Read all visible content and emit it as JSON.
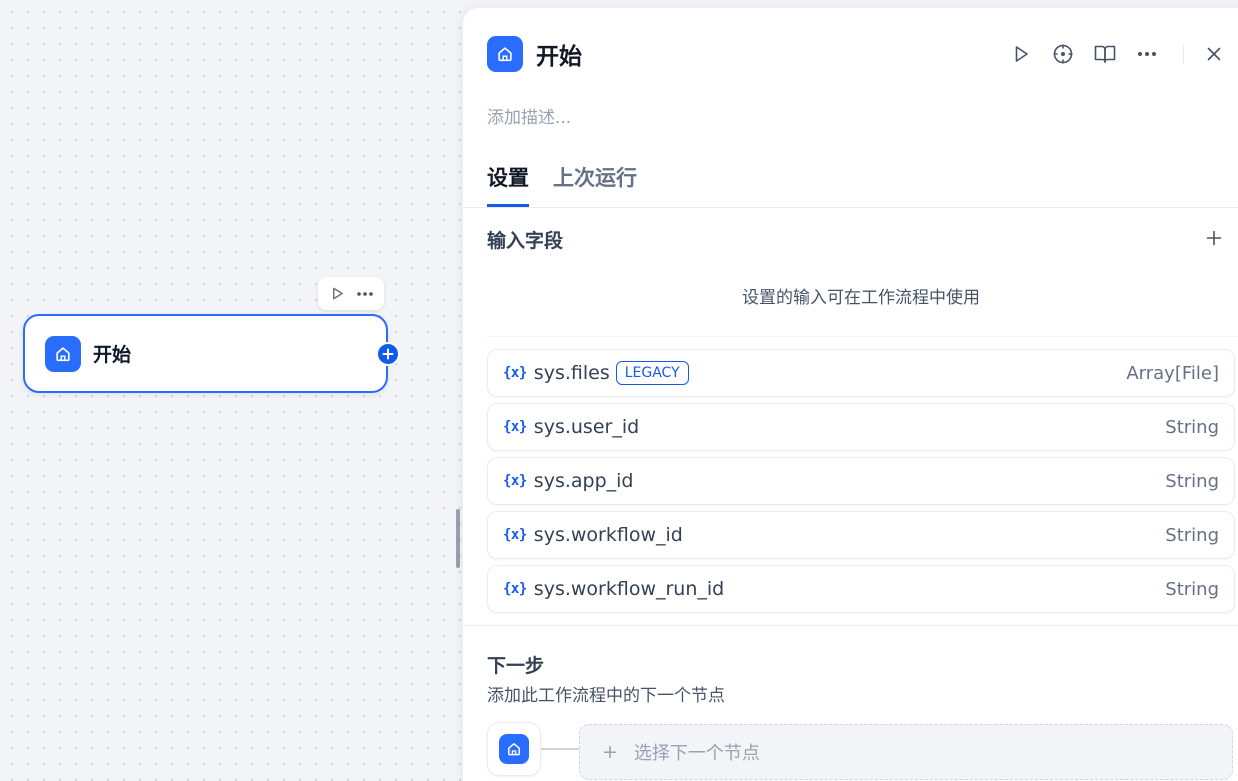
{
  "canvas": {
    "node": {
      "title": "开始",
      "icon": "home-icon"
    },
    "toolbar": {
      "run_icon": "play-icon",
      "more_icon": "more-icon"
    }
  },
  "panel": {
    "title": "开始",
    "icon": "home-icon",
    "description_placeholder": "添加描述...",
    "actions": [
      "play-icon",
      "locate-icon",
      "book-icon",
      "more-icon",
      "close-icon"
    ],
    "tabs": [
      {
        "label": "设置",
        "active": true
      },
      {
        "label": "上次运行",
        "active": false
      }
    ],
    "input_section": {
      "title": "输入字段",
      "hint": "设置的输入可在工作流程中使用",
      "variable_icon_text": "{x}",
      "variables": [
        {
          "name": "sys.files",
          "badge": "LEGACY",
          "type": "Array[File]"
        },
        {
          "name": "sys.user_id",
          "badge": "",
          "type": "String"
        },
        {
          "name": "sys.app_id",
          "badge": "",
          "type": "String"
        },
        {
          "name": "sys.workflow_id",
          "badge": "",
          "type": "String"
        },
        {
          "name": "sys.workflow_run_id",
          "badge": "",
          "type": "String"
        }
      ]
    },
    "next_step": {
      "title": "下一步",
      "description": "添加此工作流程中的下一个节点",
      "select_label": "选择下一个节点",
      "plus": "+"
    }
  },
  "colors": {
    "accent": "#155aef",
    "node_border": "#296dff",
    "badge_bg": "#296dff"
  }
}
